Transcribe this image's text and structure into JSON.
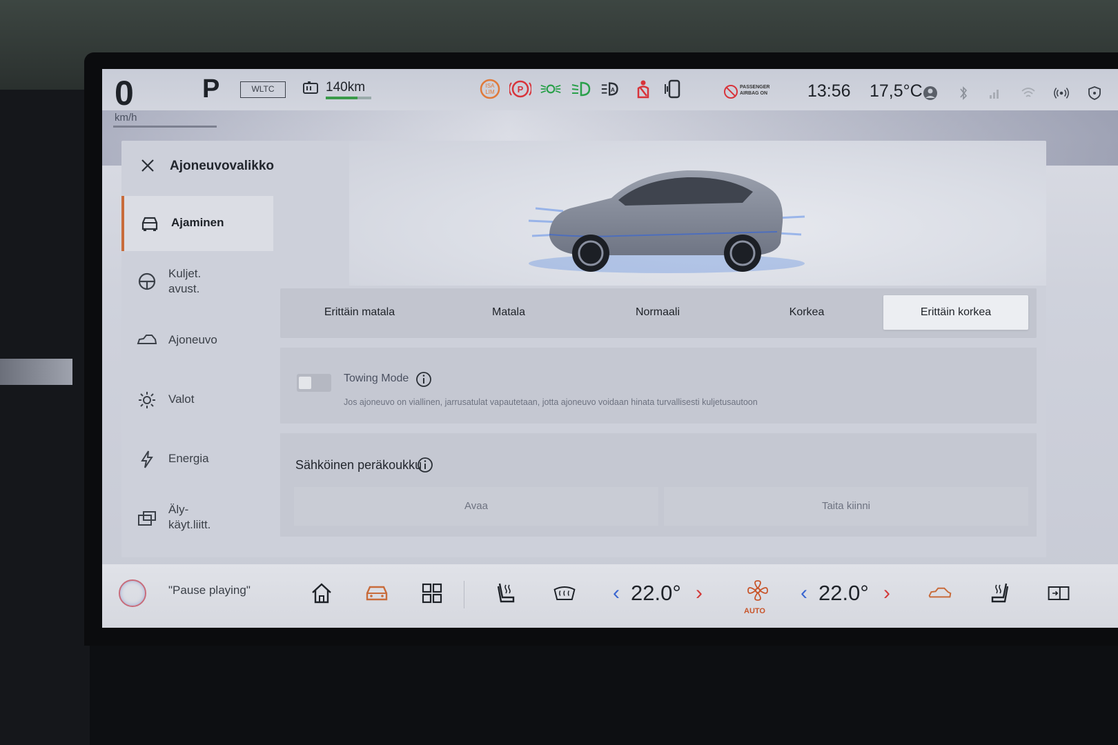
{
  "status": {
    "speed": "0",
    "speed_unit": "km/h",
    "gear": "P",
    "cycle": "WLTC",
    "range": "140km",
    "time": "13:56",
    "outside_temp": "17,5°C",
    "airbag_label": "PASSENGER AIRBAG ON"
  },
  "panel": {
    "title": "Ajoneuvovalikko",
    "sidebar": [
      {
        "label": "Ajaminen",
        "icon": "car-front-icon",
        "active": true
      },
      {
        "label": "Kuljet.\navust.",
        "icon": "steering-wheel-icon",
        "active": false
      },
      {
        "label": "Ajoneuvo",
        "icon": "car-side-icon",
        "active": false
      },
      {
        "label": "Valot",
        "icon": "sun-icon",
        "active": false
      },
      {
        "label": "Energia",
        "icon": "lightning-icon",
        "active": false
      },
      {
        "label": "Äly-\nkäyt.liitt.",
        "icon": "smart-device-icon",
        "active": false
      }
    ],
    "ride_height": {
      "options": [
        "Erittäin matala",
        "Matala",
        "Normaali",
        "Korkea",
        "Erittäin korkea"
      ],
      "selected": "Erittäin korkea"
    },
    "towing": {
      "title": "Towing Mode",
      "description": "Jos ajoneuvo on viallinen, jarrusatulat vapautetaan, jotta ajoneuvo voidaan hinata turvallisesti kuljetusautoon",
      "enabled": false
    },
    "tow_hitch": {
      "title": "Sähköinen peräkoukku",
      "open_label": "Avaa",
      "fold_label": "Taita kiinni"
    }
  },
  "dock": {
    "assistant_text": "\"Pause playing\"",
    "driver_temp": "22.0°",
    "passenger_temp": "22.0°",
    "fan_mode": "AUTO"
  },
  "colors": {
    "accent": "#c86b3a",
    "temp_down": "#3a66d0",
    "temp_up": "#d23a3a"
  }
}
